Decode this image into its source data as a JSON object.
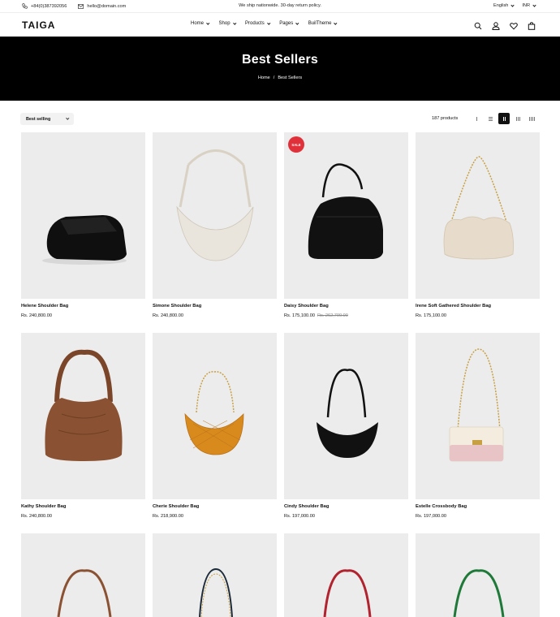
{
  "topbar": {
    "phone": "+84(0)387392056",
    "email": "hello@domain.com",
    "announcement": "We ship nationwide. 30-day return policy.",
    "language": "English",
    "currency": "INR"
  },
  "header": {
    "logo": "TAIGA",
    "nav": [
      {
        "label": "Home"
      },
      {
        "label": "Shop"
      },
      {
        "label": "Products"
      },
      {
        "label": "Pages"
      },
      {
        "label": "BuilTheme"
      }
    ],
    "icons": [
      "search-icon",
      "user-icon",
      "heart-icon",
      "bag-icon"
    ]
  },
  "banner": {
    "title": "Best Sellers",
    "breadcrumb_home": "Home",
    "breadcrumb_sep": "/",
    "breadcrumb_current": "Best Sellers"
  },
  "toolbar": {
    "sort_value": "Best selling",
    "product_count": "187 products"
  },
  "products": [
    {
      "name": "Helene Shoulder Bag",
      "price": "Rs. 240,800.00",
      "compare": "",
      "badge": "",
      "color": "#0f0f0f"
    },
    {
      "name": "Simone Shoulder Bag",
      "price": "Rs. 240,800.00",
      "compare": "",
      "badge": "",
      "color": "#e9e4dc"
    },
    {
      "name": "Daisy Shoulder Bag",
      "price": "Rs. 175,100.00",
      "compare": "Rs. 262,700.00",
      "badge": "SALE",
      "color": "#111111"
    },
    {
      "name": "Irene Soft Gathered Shoulder Bag",
      "price": "Rs. 175,100.00",
      "compare": "",
      "badge": "",
      "color": "#e7dccb"
    },
    {
      "name": "Kathy Shoulder Bag",
      "price": "Rs. 240,800.00",
      "compare": "",
      "badge": "",
      "color": "#8a5232"
    },
    {
      "name": "Cherie Shoulder Bag",
      "price": "Rs. 218,900.00",
      "compare": "",
      "badge": "",
      "color": "#d88a1d"
    },
    {
      "name": "Cindy Shoulder Bag",
      "price": "Rs. 197,000.00",
      "compare": "",
      "badge": "",
      "color": "#111111"
    },
    {
      "name": "Estelle Crossbody Bag",
      "price": "Rs. 197,000.00",
      "compare": "",
      "badge": "",
      "color": "#f3ecdf"
    }
  ],
  "partial_row_colors": [
    "#8a5232",
    "#1d2a3a",
    "#b1232f",
    "#1f7a3a"
  ]
}
